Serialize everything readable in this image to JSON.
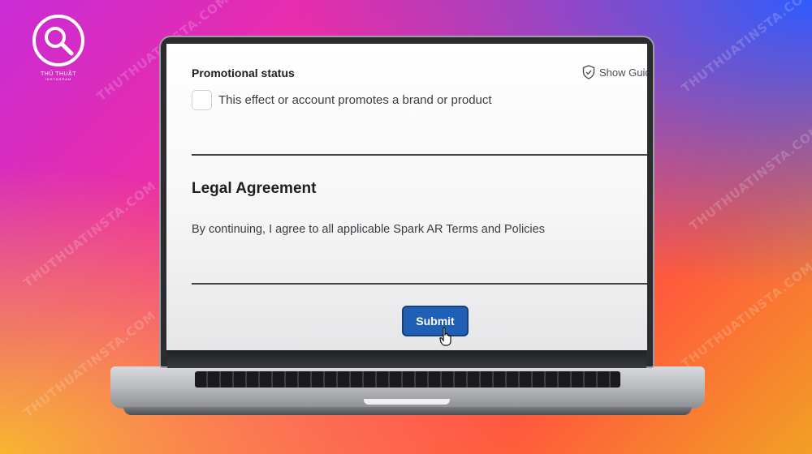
{
  "logo": {
    "line1": "THỦ THUẬT",
    "line2": "INSTAGRAM"
  },
  "watermark": "THUTHUATINSTA.COM",
  "form": {
    "promotional_title": "Promotional status",
    "show_guide": "Show Guid",
    "checkbox_label": "This effect or account promotes a brand or product",
    "checkbox_checked": false,
    "legal_title": "Legal Agreement",
    "legal_text": "By continuing, I agree to all applicable Spark AR Terms and Policies",
    "submit_label": "Submit"
  },
  "colors": {
    "submit_button": "#1f5fb5",
    "text_primary": "#1c1e21"
  },
  "icons": [
    "search-icon",
    "shield-check-icon",
    "hand-pointer-icon"
  ]
}
